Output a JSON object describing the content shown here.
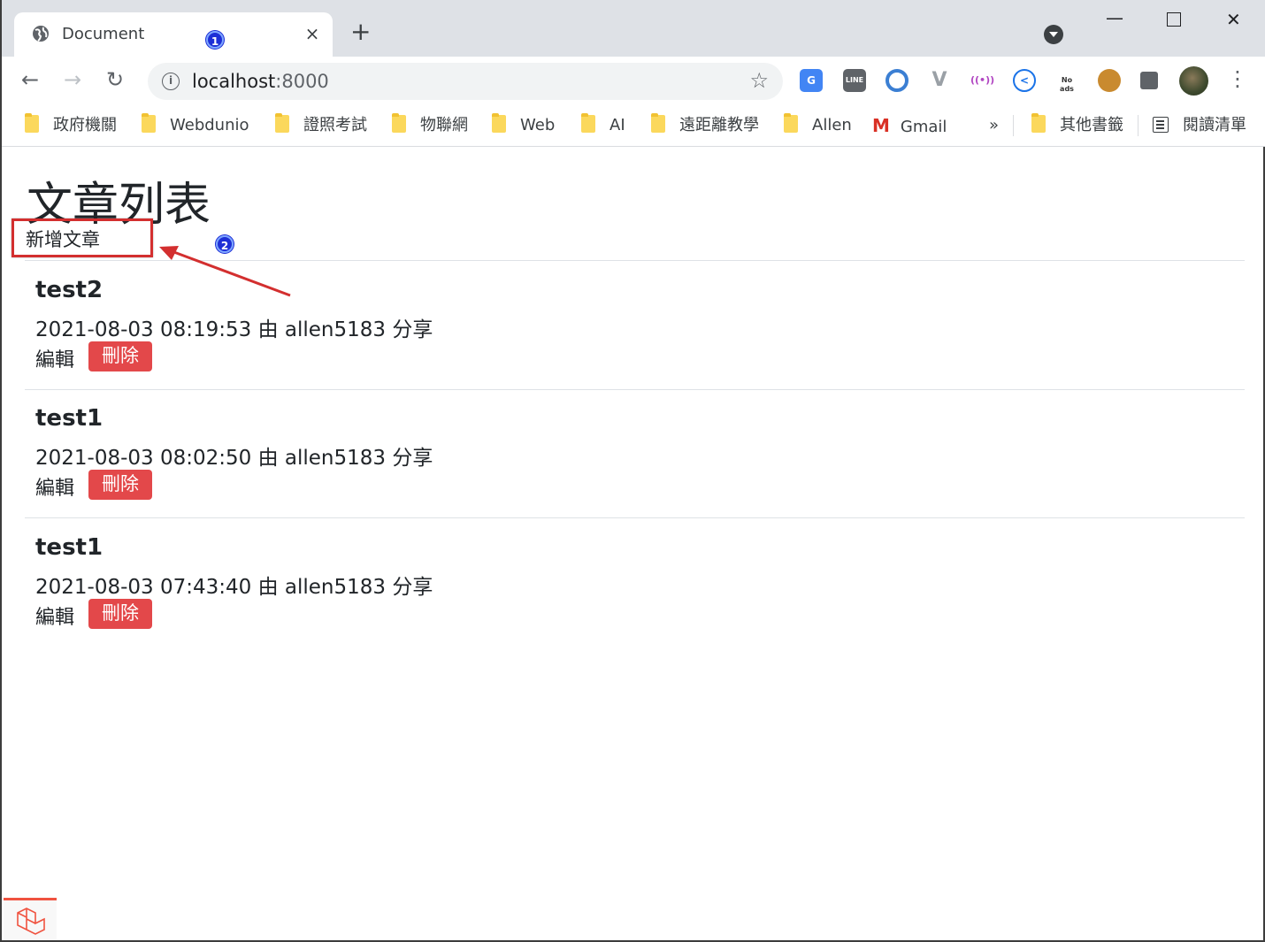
{
  "tab": {
    "title": "Document",
    "close": "×"
  },
  "tabstrip": {
    "new_tab": "+"
  },
  "annotations": {
    "badge1": "1",
    "badge2": "2",
    "arrow_color": "#d32f2f",
    "badge_color": "#1d2fd6"
  },
  "toolbar": {
    "back": "←",
    "forward": "→",
    "reload": "↻",
    "url_host": "localhost",
    "url_port": ":8000",
    "bookmark_star": "☆",
    "menu": "⋮",
    "extensions": [
      {
        "name": "google-translate-icon",
        "label": "G",
        "color": "#4285f4"
      },
      {
        "name": "line-icon",
        "label": "LINE",
        "color": "#5f6368"
      },
      {
        "name": "circle-ext-icon",
        "label": "",
        "color": "#3b7fd3"
      },
      {
        "name": "vue-devtools-icon",
        "label": "V",
        "color": "#9aa0a6"
      },
      {
        "name": "broadcast-icon",
        "label": "((•))",
        "color": "#b146c2"
      },
      {
        "name": "share-icon",
        "label": "<",
        "color": "#1a73e8"
      },
      {
        "name": "no-ads-icon",
        "label": "No ads",
        "color": "#ea4335"
      },
      {
        "name": "cookie-icon",
        "label": "",
        "color": "#c98a2f"
      },
      {
        "name": "puzzle-icon",
        "label": "",
        "color": "#5f6368"
      }
    ]
  },
  "bookmarks": {
    "items": [
      "政府機關",
      "Webdunio",
      "證照考試",
      "物聯網",
      "Web",
      "AI",
      "遠距離教學",
      "Allen"
    ],
    "gmail": "Gmail",
    "more": "»",
    "other": "其他書籤",
    "reading_list": "閱讀清單"
  },
  "page": {
    "title": "文章列表",
    "new_post": "新增文章",
    "posts": [
      {
        "title": "test2",
        "meta": "2021-08-03 08:19:53 由 allen5183 分享",
        "edit": "編輯",
        "delete": "刪除"
      },
      {
        "title": "test1",
        "meta": "2021-08-03 08:02:50 由 allen5183 分享",
        "edit": "編輯",
        "delete": "刪除"
      },
      {
        "title": "test1",
        "meta": "2021-08-03 07:43:40 由 allen5183 分享",
        "edit": "編輯",
        "delete": "刪除"
      }
    ],
    "delete_color": "#e3484a"
  }
}
